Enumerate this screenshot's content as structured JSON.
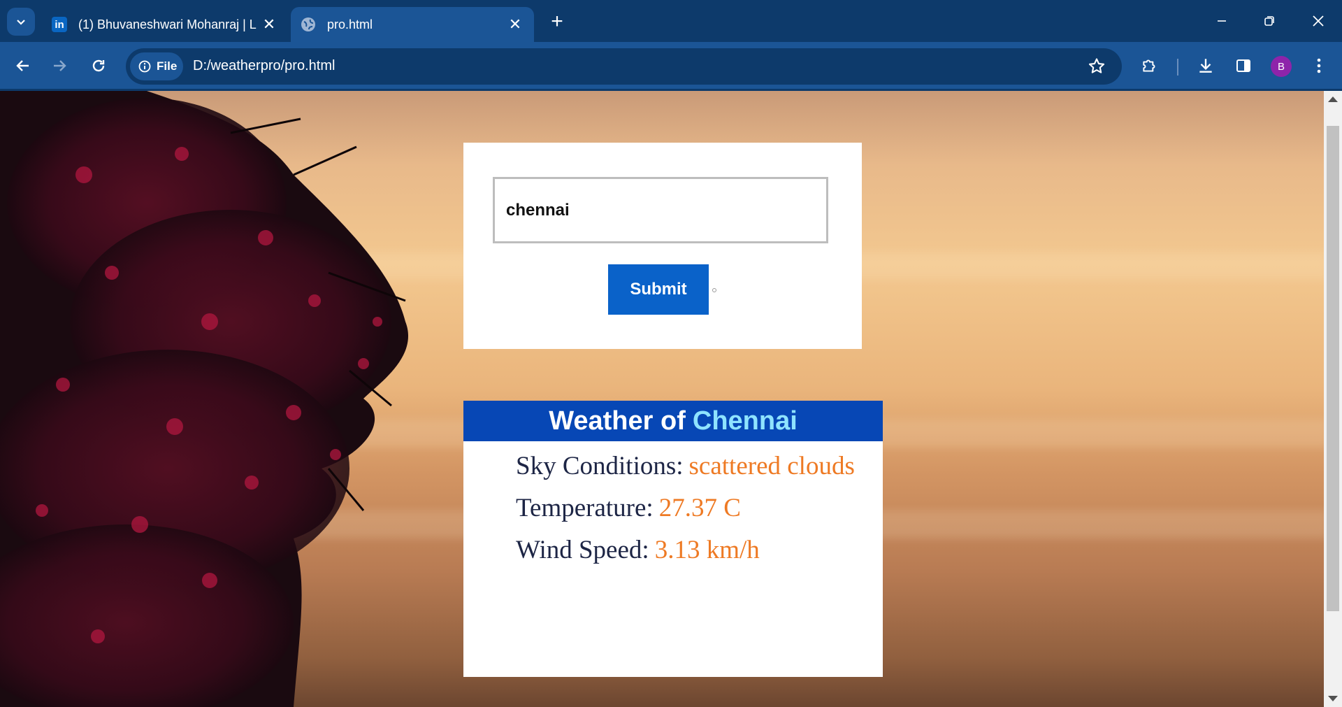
{
  "browser": {
    "tabs": [
      {
        "title": "(1) Bhuvaneshwari Mohanraj | L",
        "favicon": "linkedin-icon",
        "favicon_text": "in",
        "active": false
      },
      {
        "title": "pro.html",
        "favicon": "globe-icon",
        "active": true
      }
    ],
    "address": {
      "chip_label": "File",
      "url": "D:/weatherpro/pro.html"
    },
    "profile_initial": "B",
    "colors": {
      "frame": "#0d3a6b",
      "toolbar": "#1b5596",
      "avatar": "#8e24aa"
    }
  },
  "page": {
    "search": {
      "input_value": "chennai",
      "submit_label": "Submit"
    },
    "weather": {
      "heading_prefix": "Weather of",
      "city": "Chennai",
      "rows": [
        {
          "label": "Sky Conditions:",
          "value": "scattered clouds"
        },
        {
          "label": "Temperature:",
          "value": "27.37 C"
        },
        {
          "label": "Wind Speed:",
          "value": "3.13 km/h"
        }
      ]
    },
    "colors": {
      "header_bg": "#0747b5",
      "city": "#8fe3ff",
      "value": "#ee7a24",
      "button": "#0a62c9"
    }
  }
}
